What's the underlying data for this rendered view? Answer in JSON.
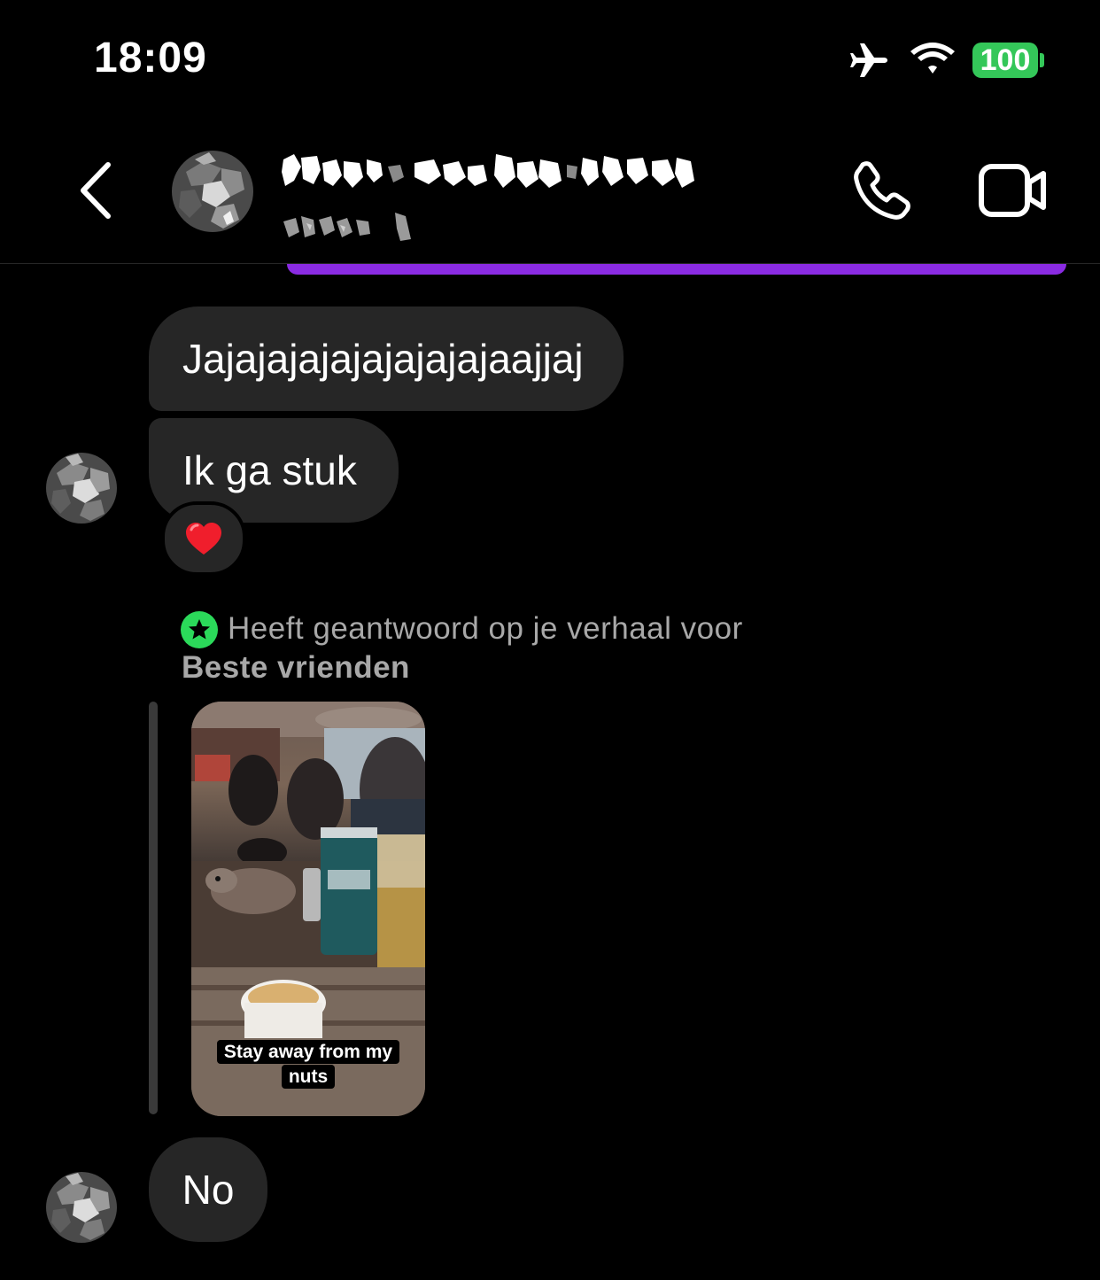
{
  "status_bar": {
    "time": "18:09",
    "battery": "100",
    "icons": [
      "airplane-icon",
      "wifi-icon",
      "battery-icon"
    ]
  },
  "header": {
    "name": "",
    "subtitle": "",
    "icons": [
      "back-icon",
      "avatar",
      "phone-icon",
      "video-icon"
    ]
  },
  "messages": [
    {
      "text": "Jajajajajajajajajajaajjaj"
    },
    {
      "text": "Ik ga stuk",
      "reaction": "❤️"
    },
    {
      "text": "No"
    }
  ],
  "story_reply": {
    "caption": "Heeft geantwoord op je verhaal voor",
    "list_name": "Beste vrienden",
    "overlay_text_line1": "Stay away from my",
    "overlay_text_line2": "nuts",
    "icon": "star-icon"
  },
  "colors": {
    "background": "#000000",
    "bubble": "#262626",
    "battery": "#34c759",
    "close_friends": "#2bd95a",
    "accent": "#8a2be2"
  }
}
